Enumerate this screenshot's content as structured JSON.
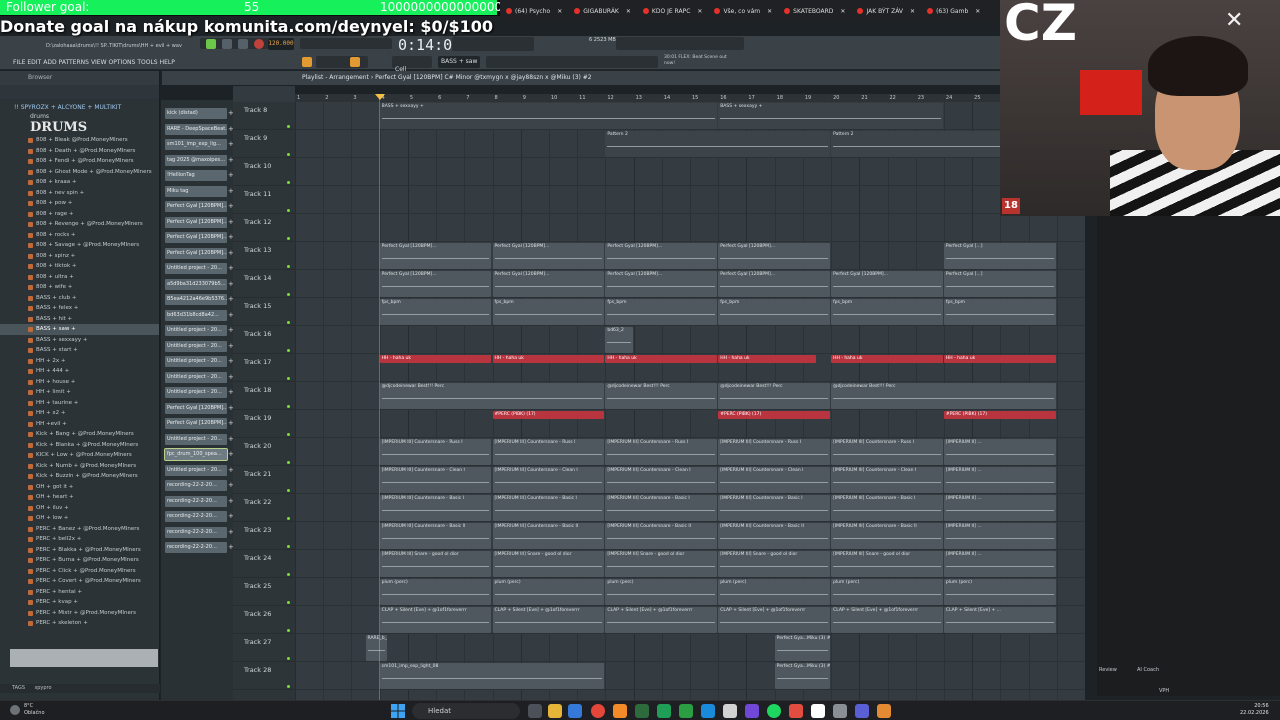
{
  "overlay": {
    "follower_label": "Follower goal:",
    "follower_count": "55",
    "follower_target": "1000000000000000000",
    "follower_progress": 0.994,
    "donate_text": "Donate goal na nákup komunita.com/deynyel: $0/$100"
  },
  "browser_tabs": [
    "(64) Psycho",
    "GIGABURÁK",
    "KDO JE RAPC",
    "Vše, co vám",
    "SKATEBOARD",
    "JAK BÝT ZÁV",
    "(63) Gamb"
  ],
  "fl": {
    "path": "D:\\zalohaaa\\drums\\!! SP..TIKIT\\drums\\HH + evil + wav",
    "menu": [
      "FILE",
      "EDIT",
      "ADD",
      "PATTERNS",
      "VIEW",
      "OPTIONS",
      "TOOLS",
      "HELP"
    ],
    "tempo": "120.000",
    "time": "0:14:00",
    "cpu_mem": "6   2523 MB",
    "hint": "30:01 FLEX: Beat Scene out now!",
    "pattern_selector": "BASS + saw",
    "snap": "Cell",
    "playlist_title": "Playlist - Arrangement › Perfect Gyal [120BPM] C# Minor @txmygn x @jay88szn x @Miku (3) #2"
  },
  "browser": {
    "header": "Browser",
    "section": "!! SPYROZX + ALCYONE + MULTIKIT",
    "subfolder": "drums",
    "logo": "DRUMS",
    "items": [
      "808 + Bleak @Prod.MoneyMIners",
      "808 + Death + @Prod.MoneyMIners",
      "808 + Fendi + @Prod.MoneyMIners",
      "808 + Ghost Mode + @Prod.MoneyMIners",
      "808 + kraaa +",
      "808 + nev spin +",
      "808 + pow +",
      "808 + rage +",
      "808 + Revenge + @Prod.MoneyMIners",
      "808 + rocks +",
      "808 + Savage + @Prod.MoneyMIners",
      "808 + spinz +",
      "808 + tiktok +",
      "808 + ultra +",
      "808 + wife +",
      "BASS + club +",
      "BASS + felex +",
      "BASS + hit +",
      "BASS + saw +",
      "BASS + sexxayy +",
      "BASS + start +",
      "HH + 2x +",
      "HH + 444 +",
      "HH + house +",
      "HH + limit +",
      "HH + taurine +",
      "HH + x2 +",
      "HH +evil +",
      "Kick + Bang + @Prod.MoneyMIners",
      "Kick + Blanka + @Prod.MoneyMIners",
      "KICK + Low + @Prod.MoneyMIners",
      "Kick + Numb + @Prod.MoneyMIners",
      "Kick + Buzzin + @Prod.MoneyMIners",
      "OH + got it +",
      "OH + heart +",
      "OH + iluv +",
      "OH + low +",
      "PERC + Banez + @Prod.MoneyMIners",
      "PERC + bell2x +",
      "PERC + Blakka + @Prod.MoneyMIners",
      "PERC + Burna + @Prod.MoneyMIners",
      "PERC + Click + @Prod.MoneyMIners",
      "PERC + Covert + @Prod.MoneyMIners",
      "PERC + hentai +",
      "PERC + kvap +",
      "PERC + Mistr + @Prod.MoneyMIners",
      "PERC + skeleton +"
    ],
    "selected_index": 18,
    "tags_label": "TAGS",
    "tags_value": "spypro"
  },
  "clips": [
    "kick (distad)",
    "RARE - DeepSpaceBeat...",
    "sm101_imp_exp_lig...",
    "tag 2025 @maxoipes...",
    "!HellionTag",
    "Miku tag",
    "Perfect Gyal [120BPM]...",
    "Perfect Gyal [120BPM]...",
    "Perfect Gyal [120BPM]...",
    "Perfect Gyal [120BPM]...",
    "Untitled project - 20...",
    "a5d9ba31d233079b5...",
    "B5ea4212a46e9b5376...",
    "bd63d31b8cd8a42...",
    "Untitled project - 20...",
    "Untitled project - 20...",
    "Untitled project - 20...",
    "Untitled project - 20...",
    "Untitled project - 20...",
    "Perfect Gyal [120BPM]...",
    "Perfect Gyal [120BPM]...",
    "Untitled project - 20...",
    "fpc_drum_100_spea...",
    "Untitled project - 20...",
    "recording-22-2-20...",
    "recording-22-2-20...",
    "recording-22-2-20...",
    "recording-22-2-20...",
    "recording-22-2-20..."
  ],
  "selected_clip": 22,
  "ruler": [
    "1",
    "2",
    "3",
    "4",
    "5",
    "6",
    "7",
    "8",
    "9",
    "10",
    "11",
    "12",
    "13",
    "14",
    "15",
    "16",
    "17",
    "18",
    "19",
    "20",
    "21",
    "22",
    "23",
    "24",
    "25",
    "26",
    "27",
    "28"
  ],
  "tracks": [
    {
      "name": "Track 8",
      "clips": [
        {
          "s": 4,
          "e": 16,
          "t": "BASS + sexxayy +",
          "k": "pat"
        },
        {
          "s": 16,
          "e": 24,
          "t": "BASS + sexxayy +",
          "k": "pat"
        }
      ]
    },
    {
      "name": "Track 9",
      "clips": [
        {
          "s": 12,
          "e": 20,
          "t": "Pattern 2",
          "k": "pat"
        },
        {
          "s": 20,
          "e": 28,
          "t": "Pattern 2",
          "k": "pat"
        }
      ]
    },
    {
      "name": "Track 10",
      "clips": []
    },
    {
      "name": "Track 11",
      "clips": []
    },
    {
      "name": "Track 12",
      "clips": []
    },
    {
      "name": "Track 13",
      "clips": [
        {
          "s": 4,
          "e": 8,
          "t": "Perfect Gyal [120BPM]...",
          "k": "audio"
        },
        {
          "s": 8,
          "e": 12,
          "t": "Perfect Gyal [120BPM]...",
          "k": "audio"
        },
        {
          "s": 12,
          "e": 16,
          "t": "Perfect Gyal [120BPM]...",
          "k": "audio"
        },
        {
          "s": 16,
          "e": 20,
          "t": "Perfect Gyal [120BPM]...",
          "k": "audio"
        },
        {
          "s": 24,
          "e": 28,
          "t": "Perfect Gyal [...]",
          "k": "audio"
        }
      ]
    },
    {
      "name": "Track 14",
      "clips": [
        {
          "s": 4,
          "e": 8,
          "t": "Perfect Gyal [120BPM]...",
          "k": "audio"
        },
        {
          "s": 8,
          "e": 12,
          "t": "Perfect Gyal [120BPM]...",
          "k": "audio"
        },
        {
          "s": 12,
          "e": 16,
          "t": "Perfect Gyal [120BPM]...",
          "k": "audio"
        },
        {
          "s": 16,
          "e": 20,
          "t": "Perfect Gyal [120BPM]...",
          "k": "audio"
        },
        {
          "s": 20,
          "e": 24,
          "t": "Perfect Gyal [120BPM]...",
          "k": "audio"
        },
        {
          "s": 24,
          "e": 28,
          "t": "Perfect Gyal [...]",
          "k": "audio"
        }
      ]
    },
    {
      "name": "Track 15",
      "clips": [
        {
          "s": 4,
          "e": 8,
          "t": "fps_bpm",
          "k": "audio"
        },
        {
          "s": 8,
          "e": 12,
          "t": "fps_bpm",
          "k": "audio"
        },
        {
          "s": 12,
          "e": 16,
          "t": "fps_bpm",
          "k": "audio"
        },
        {
          "s": 16,
          "e": 20,
          "t": "fps_bpm",
          "k": "audio"
        },
        {
          "s": 20,
          "e": 24,
          "t": "fps_bpm",
          "k": "audio"
        },
        {
          "s": 24,
          "e": 28,
          "t": "fps_bpm",
          "k": "audio"
        }
      ]
    },
    {
      "name": "Track 16",
      "clips": [
        {
          "s": 12,
          "e": 13,
          "t": "bd63_2",
          "k": "audio"
        }
      ]
    },
    {
      "name": "Track 17",
      "clips": [
        {
          "s": 4,
          "e": 8,
          "t": "HH - haha uk",
          "k": "red"
        },
        {
          "s": 8,
          "e": 12,
          "t": "HH - haha uk",
          "k": "red"
        },
        {
          "s": 12,
          "e": 16,
          "t": "HH - haha uk",
          "k": "red"
        },
        {
          "s": 16,
          "e": 19.5,
          "t": "HH - haha uk",
          "k": "red"
        },
        {
          "s": 20,
          "e": 24,
          "t": "HH - haha uk",
          "k": "red"
        },
        {
          "s": 24,
          "e": 28,
          "t": "HH - haha uk",
          "k": "red"
        }
      ]
    },
    {
      "name": "Track 18",
      "clips": [
        {
          "s": 4,
          "e": 12,
          "t": "@djcodeinewar Best!!! Perc",
          "k": "audio"
        },
        {
          "s": 12,
          "e": 16,
          "t": "@djcodeinewar Best!!! Perc",
          "k": "audio"
        },
        {
          "s": 16,
          "e": 20,
          "t": "@djcodeinewar Best!!! Perc",
          "k": "audio"
        },
        {
          "s": 20,
          "e": 28,
          "t": "@djcodeinewar Best!!! Perc",
          "k": "audio"
        }
      ]
    },
    {
      "name": "Track 19",
      "clips": [
        {
          "s": 8,
          "e": 12,
          "t": "#PERC (PIBK) (17)",
          "k": "red"
        },
        {
          "s": 16,
          "e": 20,
          "t": "#PERC (PIBK) (17)",
          "k": "red"
        },
        {
          "s": 24,
          "e": 28,
          "t": "#PERC (PIBK) (17)",
          "k": "red"
        }
      ]
    },
    {
      "name": "Track 20",
      "clips": [
        {
          "s": 4,
          "e": 8,
          "t": "[IMPERIUM III] Countersnare - Russ I",
          "k": "audio"
        },
        {
          "s": 8,
          "e": 12,
          "t": "[IMPERIUM III] Countersnare - Russ I",
          "k": "audio"
        },
        {
          "s": 12,
          "e": 16,
          "t": "[IMPERIUM III] Countersnare - Russ I",
          "k": "audio"
        },
        {
          "s": 16,
          "e": 20,
          "t": "[IMPERIUM III] Countersnare - Russ I",
          "k": "audio"
        },
        {
          "s": 20,
          "e": 24,
          "t": "[IMPERIUM III] Countersnare - Russ I",
          "k": "audio"
        },
        {
          "s": 24,
          "e": 28,
          "t": "[IMPERIUM II] ...",
          "k": "audio"
        }
      ]
    },
    {
      "name": "Track 21",
      "clips": [
        {
          "s": 4,
          "e": 8,
          "t": "[IMPERIUM III] Countersnare - Clean I",
          "k": "audio"
        },
        {
          "s": 8,
          "e": 12,
          "t": "[IMPERIUM III] Countersnare - Clean I",
          "k": "audio"
        },
        {
          "s": 12,
          "e": 16,
          "t": "[IMPERIUM III] Countersnare - Clean I",
          "k": "audio"
        },
        {
          "s": 16,
          "e": 20,
          "t": "[IMPERIUM III] Countersnare - Clean I",
          "k": "audio"
        },
        {
          "s": 20,
          "e": 24,
          "t": "[IMPERIUM III] Countersnare - Clean I",
          "k": "audio"
        },
        {
          "s": 24,
          "e": 28,
          "t": "[IMPERIUM II] ...",
          "k": "audio"
        }
      ]
    },
    {
      "name": "Track 22",
      "clips": [
        {
          "s": 4,
          "e": 8,
          "t": "[IMPERIUM III] Countersnare - Basic I",
          "k": "audio"
        },
        {
          "s": 8,
          "e": 12,
          "t": "[IMPERIUM III] Countersnare - Basic I",
          "k": "audio"
        },
        {
          "s": 12,
          "e": 16,
          "t": "[IMPERIUM III] Countersnare - Basic I",
          "k": "audio"
        },
        {
          "s": 16,
          "e": 20,
          "t": "[IMPERIUM III] Countersnare - Basic I",
          "k": "audio"
        },
        {
          "s": 20,
          "e": 24,
          "t": "[IMPERIUM III] Countersnare - Basic I",
          "k": "audio"
        },
        {
          "s": 24,
          "e": 28,
          "t": "[IMPERIUM II] ...",
          "k": "audio"
        }
      ]
    },
    {
      "name": "Track 23",
      "clips": [
        {
          "s": 4,
          "e": 8,
          "t": "[IMPERIUM III] Countersnare - Basic II",
          "k": "audio"
        },
        {
          "s": 8,
          "e": 12,
          "t": "[IMPERIUM III] Countersnare - Basic II",
          "k": "audio"
        },
        {
          "s": 12,
          "e": 16,
          "t": "[IMPERIUM III] Countersnare - Basic II",
          "k": "audio"
        },
        {
          "s": 16,
          "e": 20,
          "t": "[IMPERIUM III] Countersnare - Basic II",
          "k": "audio"
        },
        {
          "s": 20,
          "e": 24,
          "t": "[IMPERIUM III] Countersnare - Basic II",
          "k": "audio"
        },
        {
          "s": 24,
          "e": 28,
          "t": "[IMPERIUM II] ...",
          "k": "audio"
        }
      ]
    },
    {
      "name": "Track 24",
      "clips": [
        {
          "s": 4,
          "e": 8,
          "t": "[IMPERIUM III] Snare - good ol dior",
          "k": "audio"
        },
        {
          "s": 8,
          "e": 12,
          "t": "[IMPERIUM III] Snare - good ol dior",
          "k": "audio"
        },
        {
          "s": 12,
          "e": 16,
          "t": "[IMPERIUM III] Snare - good ol dior",
          "k": "audio"
        },
        {
          "s": 16,
          "e": 20,
          "t": "[IMPERIUM III] Snare - good ol dior",
          "k": "audio"
        },
        {
          "s": 20,
          "e": 24,
          "t": "[IMPERIUM III] Snare - good ol dior",
          "k": "audio"
        },
        {
          "s": 24,
          "e": 28,
          "t": "[IMPERIUM II] ...",
          "k": "audio"
        }
      ]
    },
    {
      "name": "Track 25",
      "clips": [
        {
          "s": 4,
          "e": 8,
          "t": "plum (perc)",
          "k": "audio"
        },
        {
          "s": 8,
          "e": 12,
          "t": "plum (perc)",
          "k": "audio"
        },
        {
          "s": 12,
          "e": 16,
          "t": "plum (perc)",
          "k": "audio"
        },
        {
          "s": 16,
          "e": 20,
          "t": "plum (perc)",
          "k": "audio"
        },
        {
          "s": 20,
          "e": 24,
          "t": "plum (perc)",
          "k": "audio"
        },
        {
          "s": 24,
          "e": 28,
          "t": "plum (perc)",
          "k": "audio"
        }
      ]
    },
    {
      "name": "Track 26",
      "clips": [
        {
          "s": 4,
          "e": 8,
          "t": "CLAP + Silent [Eve] + @1of1foreverrr",
          "k": "audio"
        },
        {
          "s": 8,
          "e": 12,
          "t": "CLAP + Silent [Eve] + @1of1foreverrr",
          "k": "audio"
        },
        {
          "s": 12,
          "e": 16,
          "t": "CLAP + Silent [Eve] + @1of1foreverrr",
          "k": "audio"
        },
        {
          "s": 16,
          "e": 20,
          "t": "CLAP + Silent [Eve] + @1of1foreverrr",
          "k": "audio"
        },
        {
          "s": 20,
          "e": 24,
          "t": "CLAP + Silent [Eve] + @1of1foreverrr",
          "k": "audio"
        },
        {
          "s": 24,
          "e": 28,
          "t": "CLAP + Silent [Eve] + ...",
          "k": "audio"
        }
      ]
    },
    {
      "name": "Track 27",
      "clips": [
        {
          "s": 3.5,
          "e": 4.3,
          "t": "RARE_b_18",
          "k": "audio"
        },
        {
          "s": 18,
          "e": 20,
          "t": "Perfect Gya...Miku (3) #2",
          "k": "audio"
        }
      ]
    },
    {
      "name": "Track 28",
      "clips": [
        {
          "s": 4,
          "e": 12,
          "t": "sm101_imp_exp_light_08",
          "k": "audio"
        },
        {
          "s": 18,
          "e": 20,
          "t": "Perfect Gya...Miku (3) #2",
          "k": "audio"
        }
      ]
    }
  ],
  "right_panel": {
    "review": "Review",
    "ai_coach": "AI Coach",
    "vph": "VPH"
  },
  "webcam": {
    "label": "CZ",
    "badge": "18"
  },
  "taskbar": {
    "temp": "8°C",
    "weather": "Oblačno",
    "search": "Hledat",
    "time": "20:56",
    "date": "22.02.2026"
  }
}
